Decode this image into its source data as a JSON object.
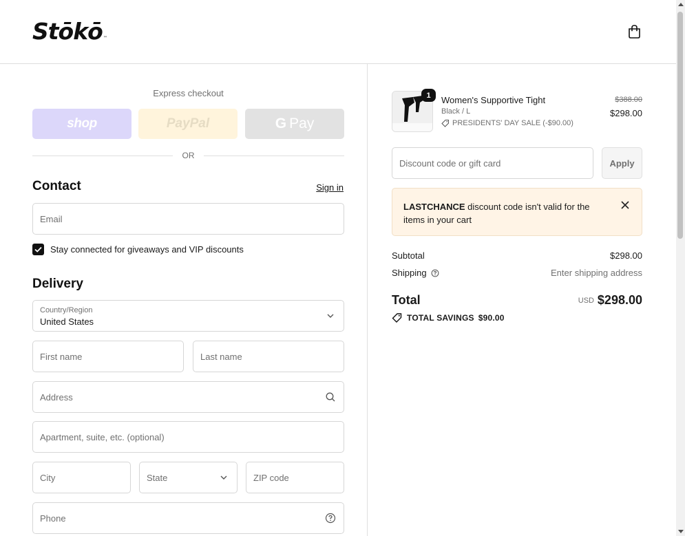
{
  "header": {
    "logo_text": "Stōkō",
    "logo_tm": "™",
    "cart_icon": "shopping-bag-icon"
  },
  "express": {
    "label": "Express checkout",
    "shop_label": "shop",
    "paypal_label": "PayPal",
    "gpay_g": "G",
    "gpay_label": "Pay",
    "or_label": "OR"
  },
  "contact": {
    "title": "Contact",
    "sign_in": "Sign in",
    "email_placeholder": "Email",
    "newsletter_label": "Stay connected for giveaways and VIP discounts",
    "newsletter_checked": true
  },
  "delivery": {
    "title": "Delivery",
    "country_label": "Country/Region",
    "country_value": "United States",
    "first_name_placeholder": "First name",
    "last_name_placeholder": "Last name",
    "address_placeholder": "Address",
    "apartment_placeholder": "Apartment, suite, etc. (optional)",
    "city_placeholder": "City",
    "state_placeholder": "State",
    "zip_placeholder": "ZIP code",
    "phone_placeholder": "Phone"
  },
  "summary": {
    "item": {
      "quantity": "1",
      "name": "Women's Supportive Tight",
      "variant": "Black / L",
      "discount_label": "PRESIDENTS' DAY SALE (-$90.00)",
      "price_original": "$388.00",
      "price_current": "$298.00"
    },
    "discount_placeholder": "Discount code or gift card",
    "apply_label": "Apply",
    "alert": {
      "code": "LASTCHANCE",
      "message": " discount code isn't valid for the items in your cart"
    },
    "subtotal_label": "Subtotal",
    "subtotal_value": "$298.00",
    "shipping_label": "Shipping",
    "shipping_value": "Enter shipping address",
    "total_label": "Total",
    "total_currency": "USD",
    "total_value": "$298.00",
    "savings_label": "TOTAL SAVINGS",
    "savings_value": "$90.00"
  },
  "colors": {
    "shop_pay": "#dcd7fa",
    "paypal": "#fff4dc",
    "gpay": "#e2e2e2",
    "alert_bg": "#fff4e6",
    "text": "#1a1a1a",
    "muted": "#707070"
  }
}
